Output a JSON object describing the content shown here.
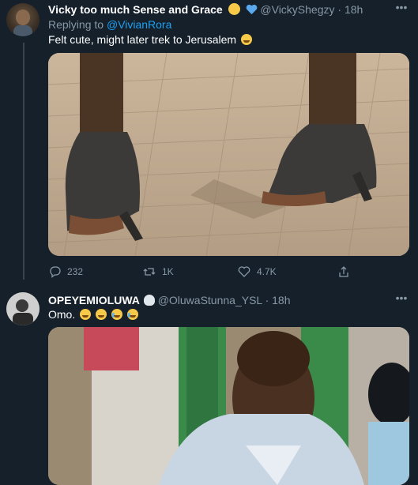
{
  "tweets": [
    {
      "display_name": "Vicky too much Sense and Grace",
      "handle": "@VickyShegzy",
      "time": "· 18h",
      "replying_prefix": "Replying to",
      "replying_to": "@VivianRora",
      "text": "Felt cute, might later trek to Jerusalem",
      "actions": {
        "replies": "232",
        "retweets": "1K",
        "likes": "4.7K"
      }
    },
    {
      "display_name": "OPEYEMIOLUWA",
      "handle": "@OluwaStunna_YSL",
      "time": "· 18h",
      "text": "Omo."
    }
  ],
  "icons": {
    "reply": "reply-icon",
    "retweet": "retweet-icon",
    "like": "heart-icon",
    "share": "share-icon",
    "more": "more-icon"
  },
  "colors": {
    "background": "#15202b",
    "link": "#1da1f2",
    "secondary_text": "#8899a6",
    "divider": "#38444d"
  }
}
